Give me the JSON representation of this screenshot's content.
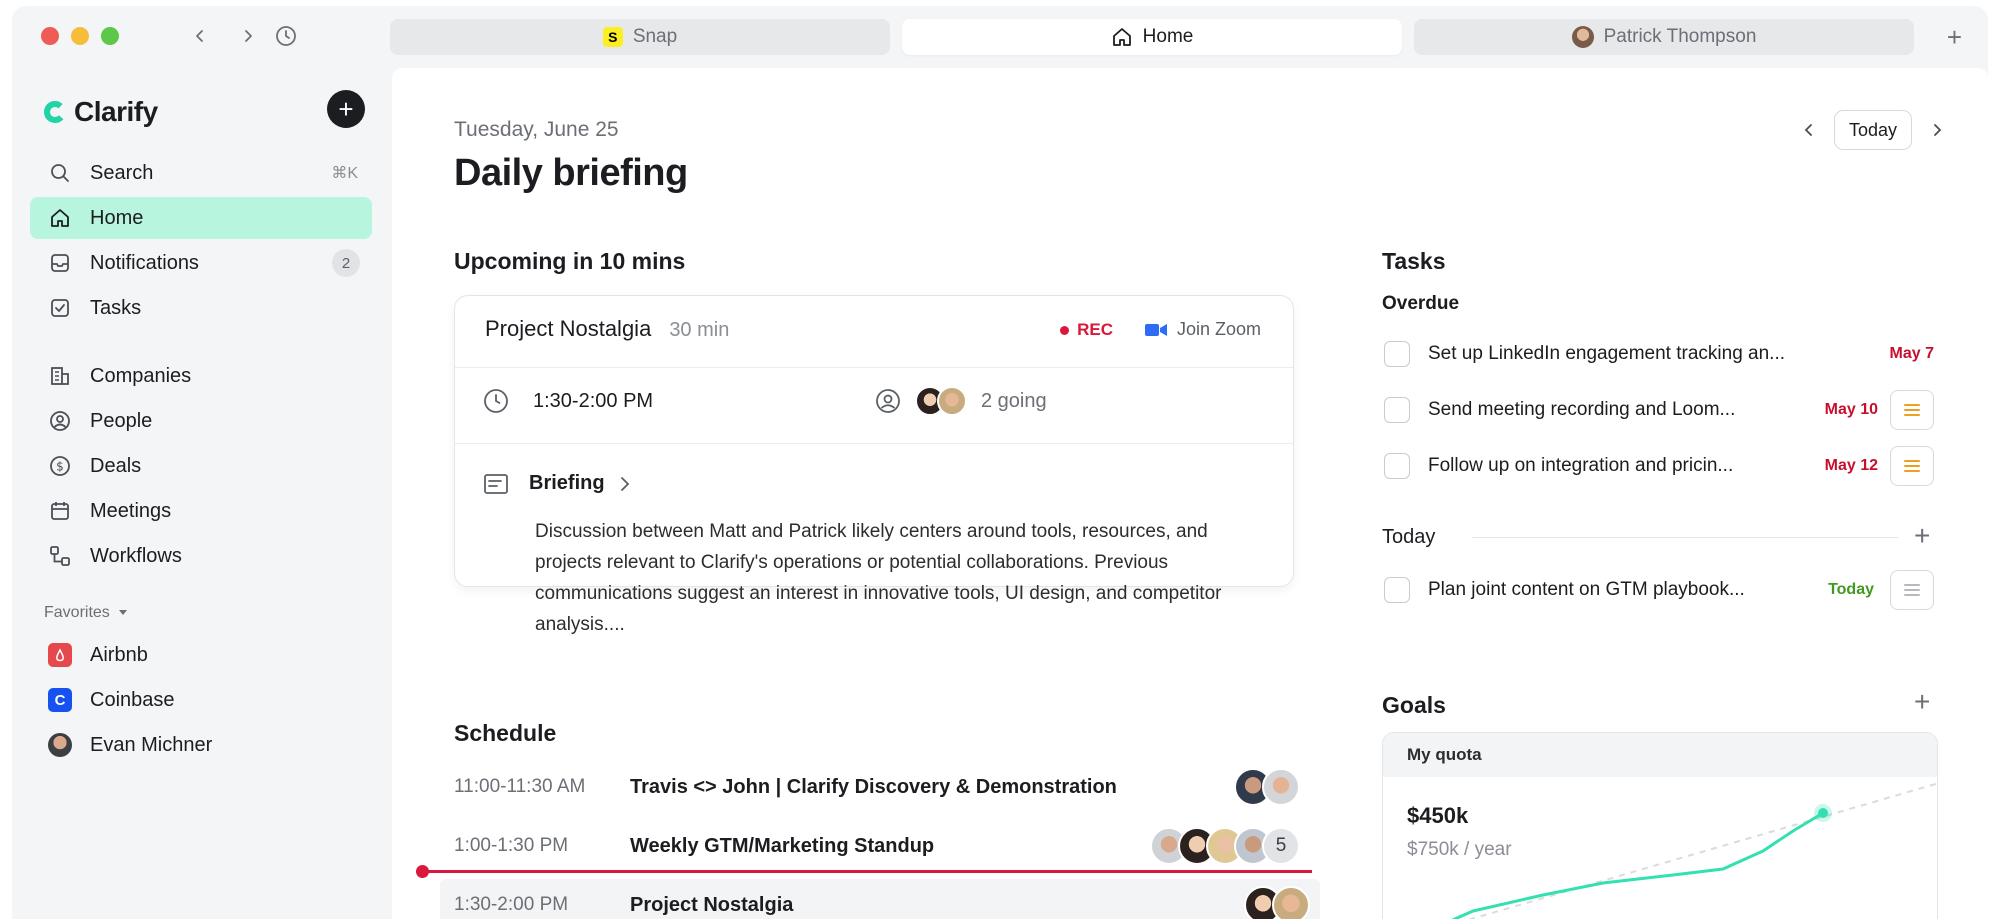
{
  "tabs": [
    {
      "label": "Snap",
      "icon": "snap-logo"
    },
    {
      "label": "Home",
      "icon": "home-icon"
    },
    {
      "label": "Patrick Thompson",
      "icon": "avatar"
    }
  ],
  "sidebar": {
    "brand": "Clarify",
    "items": [
      {
        "label": "Search",
        "shortcut": "⌘K"
      },
      {
        "label": "Home"
      },
      {
        "label": "Notifications",
        "count": "2"
      },
      {
        "label": "Tasks"
      },
      {
        "label": "Companies"
      },
      {
        "label": "People"
      },
      {
        "label": "Deals"
      },
      {
        "label": "Meetings"
      },
      {
        "label": "Workflows"
      }
    ],
    "favorites_label": "Favorites",
    "favorites": [
      {
        "label": "Airbnb",
        "color": "#e5484d"
      },
      {
        "label": "Coinbase",
        "color": "#1652f0"
      },
      {
        "label": "Evan Michner"
      }
    ]
  },
  "main": {
    "date": "Tuesday, June 25",
    "title": "Daily briefing",
    "today_button": "Today",
    "upcoming": {
      "heading": "Upcoming in 10 mins",
      "meeting": "Project Nostalgia",
      "duration": "30 min",
      "rec": "REC",
      "join": "Join Zoom",
      "time": "1:30-2:00 PM",
      "going": "2 going",
      "briefing_label": "Briefing",
      "briefing_text": "Discussion between Matt and Patrick likely centers around tools, resources, and projects relevant to Clarify's operations or potential collaborations. Previous communications suggest an interest in innovative tools, UI design, and competitor analysis...."
    },
    "schedule": {
      "heading": "Schedule",
      "rows": [
        {
          "time": "11:00-11:30 AM",
          "name": "Travis <> John | Clarify Discovery & Demonstration"
        },
        {
          "time": "1:00-1:30 PM",
          "name": "Weekly GTM/Marketing Standup",
          "more": "5"
        },
        {
          "time": "1:30-2:00 PM",
          "name": "Project Nostalgia"
        }
      ]
    },
    "tasks": {
      "heading": "Tasks",
      "overdue_label": "Overdue",
      "overdue": [
        {
          "label": "Set up LinkedIn engagement tracking an...",
          "due": "May 7"
        },
        {
          "label": "Send meeting recording and Loom...",
          "due": "May 10"
        },
        {
          "label": "Follow up on integration and pricin...",
          "due": "May 12"
        }
      ],
      "today_label": "Today",
      "today": [
        {
          "label": "Plan joint content on GTM playbook...",
          "due": "Today"
        }
      ]
    },
    "goals": {
      "heading": "Goals",
      "card_title": "My quota",
      "value": "$450k",
      "target": "$750k / year"
    }
  },
  "colors": {
    "accent": "#b8f5df",
    "rec": "#d9183b",
    "overdue": "#c8102e",
    "today_due": "#3f9a1f",
    "priority_orange": "#f0a020",
    "goal_line": "#33e0b0"
  }
}
